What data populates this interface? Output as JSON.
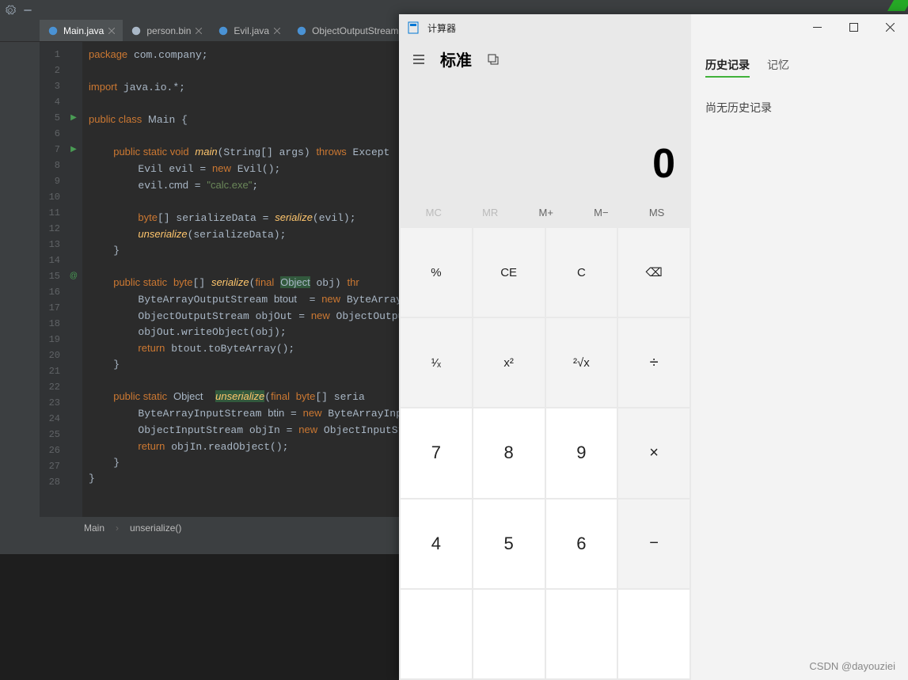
{
  "ide": {
    "tabs": [
      {
        "label": "Main.java",
        "active": true,
        "iconColor": "blue"
      },
      {
        "label": "person.bin",
        "active": false,
        "iconColor": "gray"
      },
      {
        "label": "Evil.java",
        "active": false,
        "iconColor": "blue"
      },
      {
        "label": "ObjectOutputStream",
        "active": false,
        "iconColor": "blue"
      }
    ],
    "lineCount": 28,
    "runMarkers": {
      "5": "▶",
      "7": "▶",
      "15": "@"
    },
    "code": [
      "<span class='kw'>package</span> com.company;",
      "",
      "<span class='kw'>import</span> java.io.*;",
      "",
      "<span class='kw'>public class</span> <span class='cls'>M</span>ain {",
      "",
      "    <span class='kw'>public static void</span> <span class='fn'>main</span>(String[] args) <span class='kw'>throws</span> Except",
      "        Evil evil = <span class='kw'>new</span> Evil();",
      "        evil.<span class='cls'>cmd</span> = <span class='str'>\"calc.exe\"</span>;",
      "",
      "        <span class='kw'>byte</span>[] serializeData = <span class='fn'>serialize</span>(evil);",
      "        <span class='fn'>unserialize</span>(serializeData);",
      "    }",
      "",
      "    <span class='kw'>public static</span> <span class='kw'>byte</span>[] <span class='fn'>serialize</span>(<span class='kw'>final</span> <span class='hl'>Object</span> obj) <span class='kw'>thr</span>",
      "        ByteArrayOutputStream <span class='cls'>btout</span>  = <span class='kw'>new</span> ByteArrayOutp",
      "        ObjectOutputStream objOut = <span class='kw'>new</span> ObjectOutputStre",
      "        objOut.writeObject(obj);",
      "        <span class='kw'>return</span> btout.toByteArray();",
      "    }",
      "",
      "    <span class='kw'>public static</span> <span class='cls'>Object</span>  <span class='hl'><span class='fn'>unserialize</span></span>(<span class='kw'>final</span> <span class='kw'>byte</span>[] seria",
      "        ByteArrayInputStream <span class='cls'>btin</span> = <span class='kw'>new</span> ByteArrayInputSt",
      "        ObjectInputStream objIn = <span class='kw'>new</span> ObjectInputStream(",
      "        <span class='kw'>return</span> objIn.readObject();",
      "    }",
      "}",
      ""
    ],
    "breadcrumb": {
      "class": "Main",
      "method": "unserialize()"
    }
  },
  "calc": {
    "appTitle": "计算器",
    "mode": "标准",
    "display": "0",
    "sideTabs": {
      "history": "历史记录",
      "memory": "记忆"
    },
    "sideEmpty": "尚无历史记录",
    "memButtons": [
      "MC",
      "MR",
      "M+",
      "M−",
      "MS"
    ],
    "memDisabled": [
      true,
      true,
      false,
      false,
      false
    ],
    "keys": [
      {
        "l": "%",
        "c": "fn"
      },
      {
        "l": "CE",
        "c": "fn"
      },
      {
        "l": "C",
        "c": "fn"
      },
      {
        "l": "⌫",
        "c": "fn"
      },
      {
        "l": "¹⁄ₓ",
        "c": "fn"
      },
      {
        "l": "x²",
        "c": "fn"
      },
      {
        "l": "²√x",
        "c": "fn"
      },
      {
        "l": "÷",
        "c": "op"
      },
      {
        "l": "7",
        "c": "num"
      },
      {
        "l": "8",
        "c": "num"
      },
      {
        "l": "9",
        "c": "num"
      },
      {
        "l": "×",
        "c": "op"
      },
      {
        "l": "4",
        "c": "num"
      },
      {
        "l": "5",
        "c": "num"
      },
      {
        "l": "6",
        "c": "num"
      },
      {
        "l": "−",
        "c": "op"
      }
    ]
  },
  "watermark": "CSDN @dayouziei"
}
